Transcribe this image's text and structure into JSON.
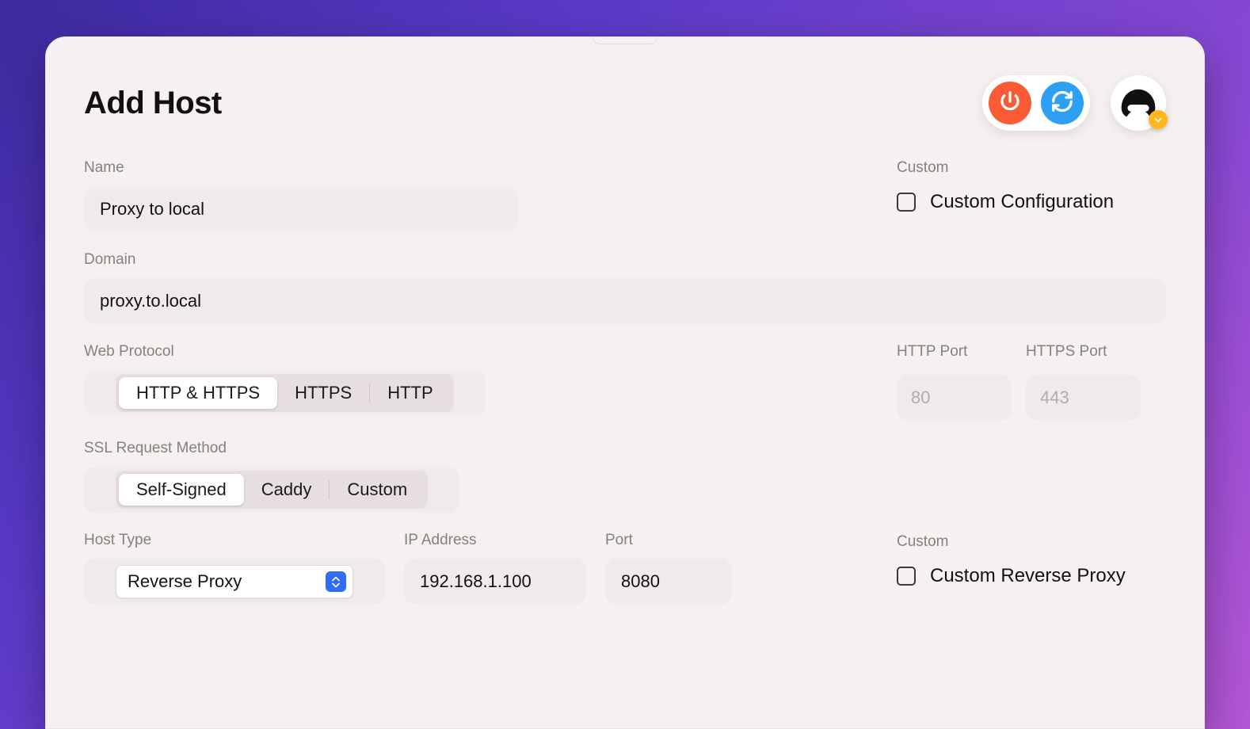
{
  "header": {
    "title": "Add Host",
    "actions": {
      "power_icon": "power-icon",
      "refresh_icon": "refresh-icon"
    }
  },
  "form": {
    "name": {
      "label": "Name",
      "value": "Proxy to local"
    },
    "domain": {
      "label": "Domain",
      "value": "proxy.to.local"
    },
    "web_protocol": {
      "label": "Web Protocol",
      "options": [
        "HTTP & HTTPS",
        "HTTPS",
        "HTTP"
      ],
      "selected": "HTTP & HTTPS"
    },
    "ssl_method": {
      "label": "SSL Request Method",
      "options": [
        "Self-Signed",
        "Caddy",
        "Custom"
      ],
      "selected": "Self-Signed"
    },
    "http_port": {
      "label": "HTTP Port",
      "placeholder": "80",
      "value": ""
    },
    "https_port": {
      "label": "HTTPS Port",
      "placeholder": "443",
      "value": ""
    },
    "host_type": {
      "label": "Host Type",
      "selected": "Reverse Proxy"
    },
    "ip_address": {
      "label": "IP Address",
      "value": "192.168.1.100"
    },
    "port": {
      "label": "Port",
      "value": "8080"
    },
    "custom1": {
      "heading": "Custom",
      "label": "Custom Configuration",
      "checked": false
    },
    "custom2": {
      "heading": "Custom",
      "label": "Custom Reverse Proxy",
      "checked": false
    }
  },
  "colors": {
    "orange": "#fa5b35",
    "blue": "#2da0f3",
    "select_accent": "#2f6df6",
    "badge": "#ffb71c"
  }
}
